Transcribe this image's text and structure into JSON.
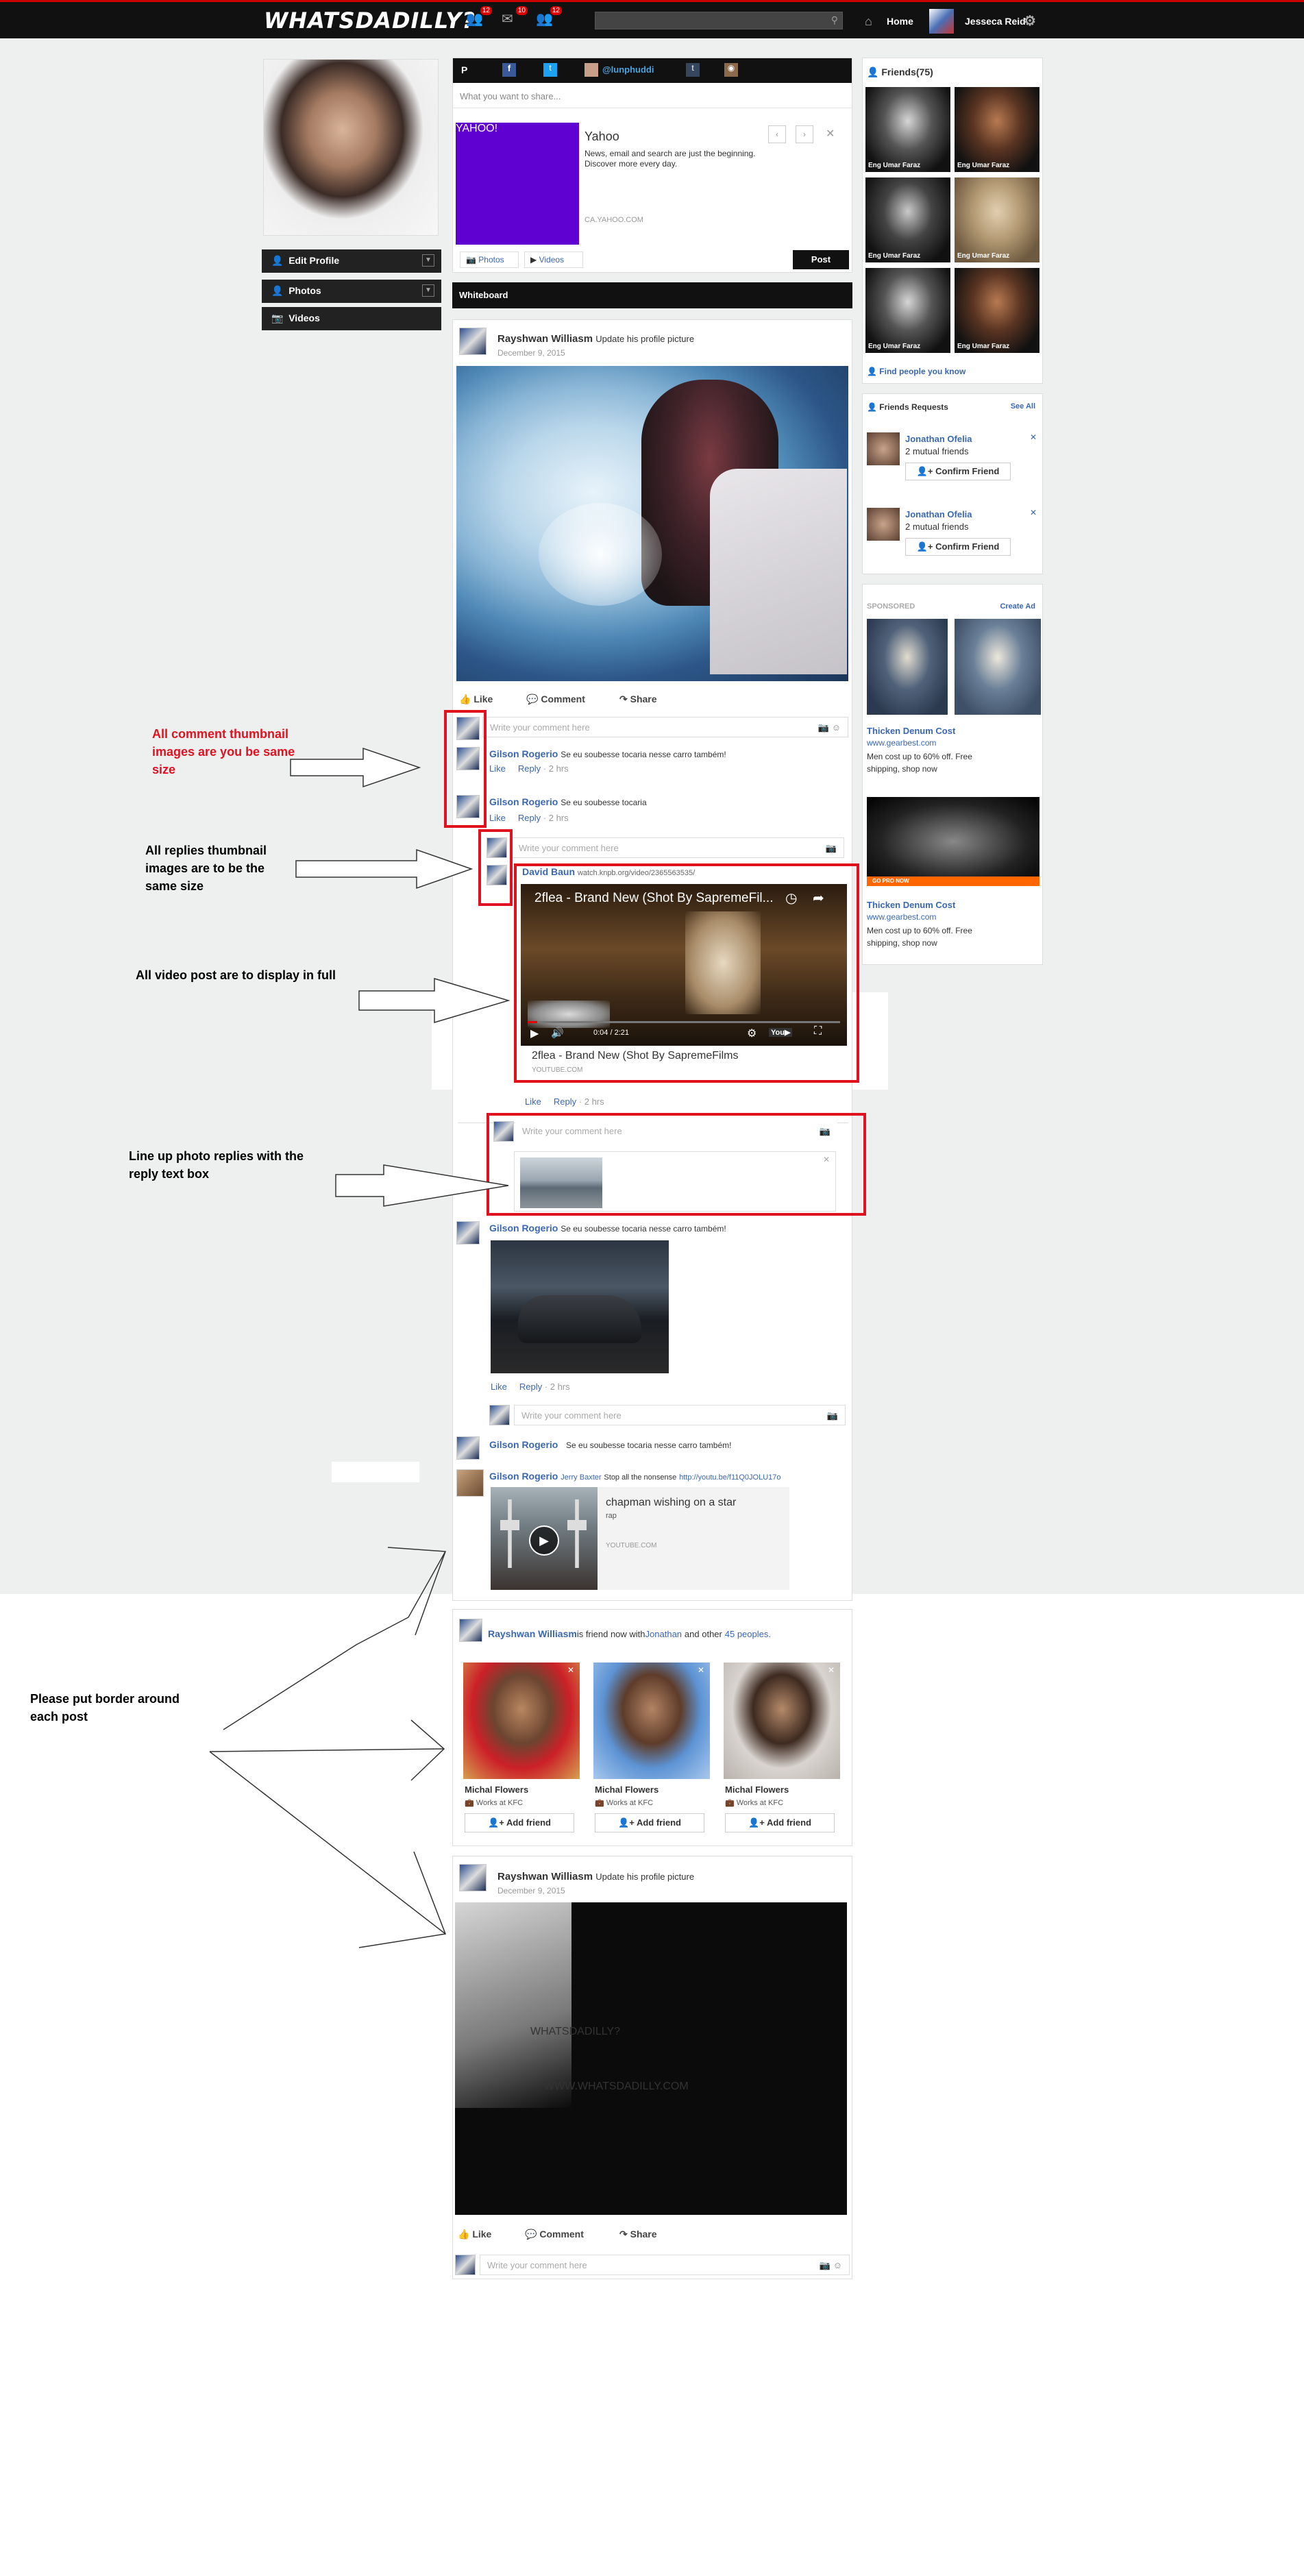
{
  "topbar": {
    "logo": "WHATSDADILLY?",
    "badges": [
      "12",
      "10",
      "12"
    ],
    "home_label": "Home",
    "user_name": "Jesseca Reid"
  },
  "left_sidebar": {
    "edit_profile": "Edit Profile",
    "photos": "Photos",
    "videos": "Videos"
  },
  "share_box": {
    "social_tag": "@lunphuddi",
    "placeholder": "What you want to share...",
    "preview_title": "Yahoo",
    "preview_desc": "News, email and search are just the beginning. Discover more every day.",
    "preview_domain": "CA.YAHOO.COM",
    "preview_logo": "YAHOO!",
    "photos_tab": "Photos",
    "videos_tab": "Videos",
    "post_button": "Post"
  },
  "whiteboard_label": "Whiteboard",
  "post1": {
    "author": "Rayshwan Williasm",
    "action": "Update his profile picture",
    "date": "December 9, 2015",
    "like": "Like",
    "comment": "Comment",
    "share": "Share",
    "comment_placeholder": "Write your comment here",
    "comments": [
      {
        "author": "Gilson Rogerio",
        "text": "Se eu soubesse tocaria nesse carro também!",
        "like": "Like",
        "reply": "Reply",
        "time": "· 2 hrs"
      },
      {
        "author": "Gilson Rogerio",
        "text": "Se eu soubesse tocaria",
        "like": "Like",
        "reply": "Reply",
        "time": "· 2 hrs"
      }
    ],
    "reply_placeholder": "Write your comment here",
    "video_reply": {
      "author": "David Baun",
      "url": "watch.knpb.org/video/2365563535/",
      "video_title": "2flea - Brand New (Shot By SapremeFil...",
      "time_readout": "0:04 / 2:21",
      "caption": "2flea - Brand New (Shot By SapremeFilms",
      "domain": "YOUTUBE.COM",
      "like": "Like",
      "reply": "Reply",
      "time": "· 2 hrs"
    },
    "photo_reply_placeholder": "Write your comment here",
    "comment3": {
      "author": "Gilson Rogerio",
      "text": "Se eu soubesse tocaria nesse carro também!",
      "like": "Like",
      "reply": "Reply",
      "time": "· 2 hrs"
    },
    "comment3_reply_placeholder": "Write your comment here",
    "comment4": {
      "author": "Gilson Rogerio",
      "text": "Se eu soubesse tocaria nesse carro também!"
    },
    "comment5": {
      "author": "Gilson Rogerio",
      "mention": "Jerry Baxter",
      "text": "Stop all the nonsense",
      "url": "http://youtu.be/f11Q0JOLU17o",
      "video_title": "chapman wishing on a star",
      "video_sub": "rap",
      "domain": "YOUTUBE.COM"
    }
  },
  "post2": {
    "author": "Rayshwan Williasm",
    "text": "is friend now with",
    "friend": "Jonathan",
    "and_other": "and other",
    "others": "45 peoples.",
    "cards": [
      {
        "name": "Michal Flowers",
        "work": "Works at KFC",
        "button": "Add friend"
      },
      {
        "name": "Michal Flowers",
        "work": "Works at KFC",
        "button": "Add friend"
      },
      {
        "name": "Michal Flowers",
        "work": "Works at KFC",
        "button": "Add friend"
      }
    ]
  },
  "post3": {
    "author": "Rayshwan Williasm",
    "action": "Update his profile picture",
    "date": "December 9, 2015",
    "shirt_text": "WHATSDADILLY?",
    "shirt_url": "WWW.WHATSDADILLY.COM",
    "like": "Like",
    "comment": "Comment",
    "share": "Share",
    "comment_placeholder": "Write your comment here"
  },
  "right_sidebar": {
    "friends_title": "Friends(75)",
    "friend_names": [
      "Eng Umar Faraz",
      "Eng Umar Faraz",
      "Eng Umar Faraz",
      "Eng Umar Faraz",
      "Eng Umar Faraz",
      "Eng Umar Faraz"
    ],
    "find_people": "Find people you know",
    "requests_title": "Friends Requests",
    "see_all": "See All",
    "requests": [
      {
        "name": "Jonathan Ofelia",
        "mutual": "2 mutual friends",
        "button": "Confirm Friend"
      },
      {
        "name": "Jonathan Ofelia",
        "mutual": "2 mutual friends",
        "button": "Confirm Friend"
      }
    ],
    "sponsored": "SPONSORED",
    "create_ad": "Create Ad",
    "ads": [
      {
        "title": "Thicken Denum Cost",
        "domain": "www.gearbest.com",
        "desc": "Men cost up to 60% off. Free shipping, shop now"
      },
      {
        "title": "Thicken Denum Cost",
        "domain": "www.gearbest.com",
        "desc": "Men cost up to 60% off. Free shipping, shop now",
        "banner": "GO PRO NOW"
      }
    ]
  },
  "annotations": {
    "a1": "All comment thumbnail images are you be same size",
    "a2": "All replies thumbnail images are to be the same size",
    "a3": "All video post are to display in full",
    "a4": "Line up photo replies with the reply text box",
    "a5": "Please put border around each post"
  }
}
